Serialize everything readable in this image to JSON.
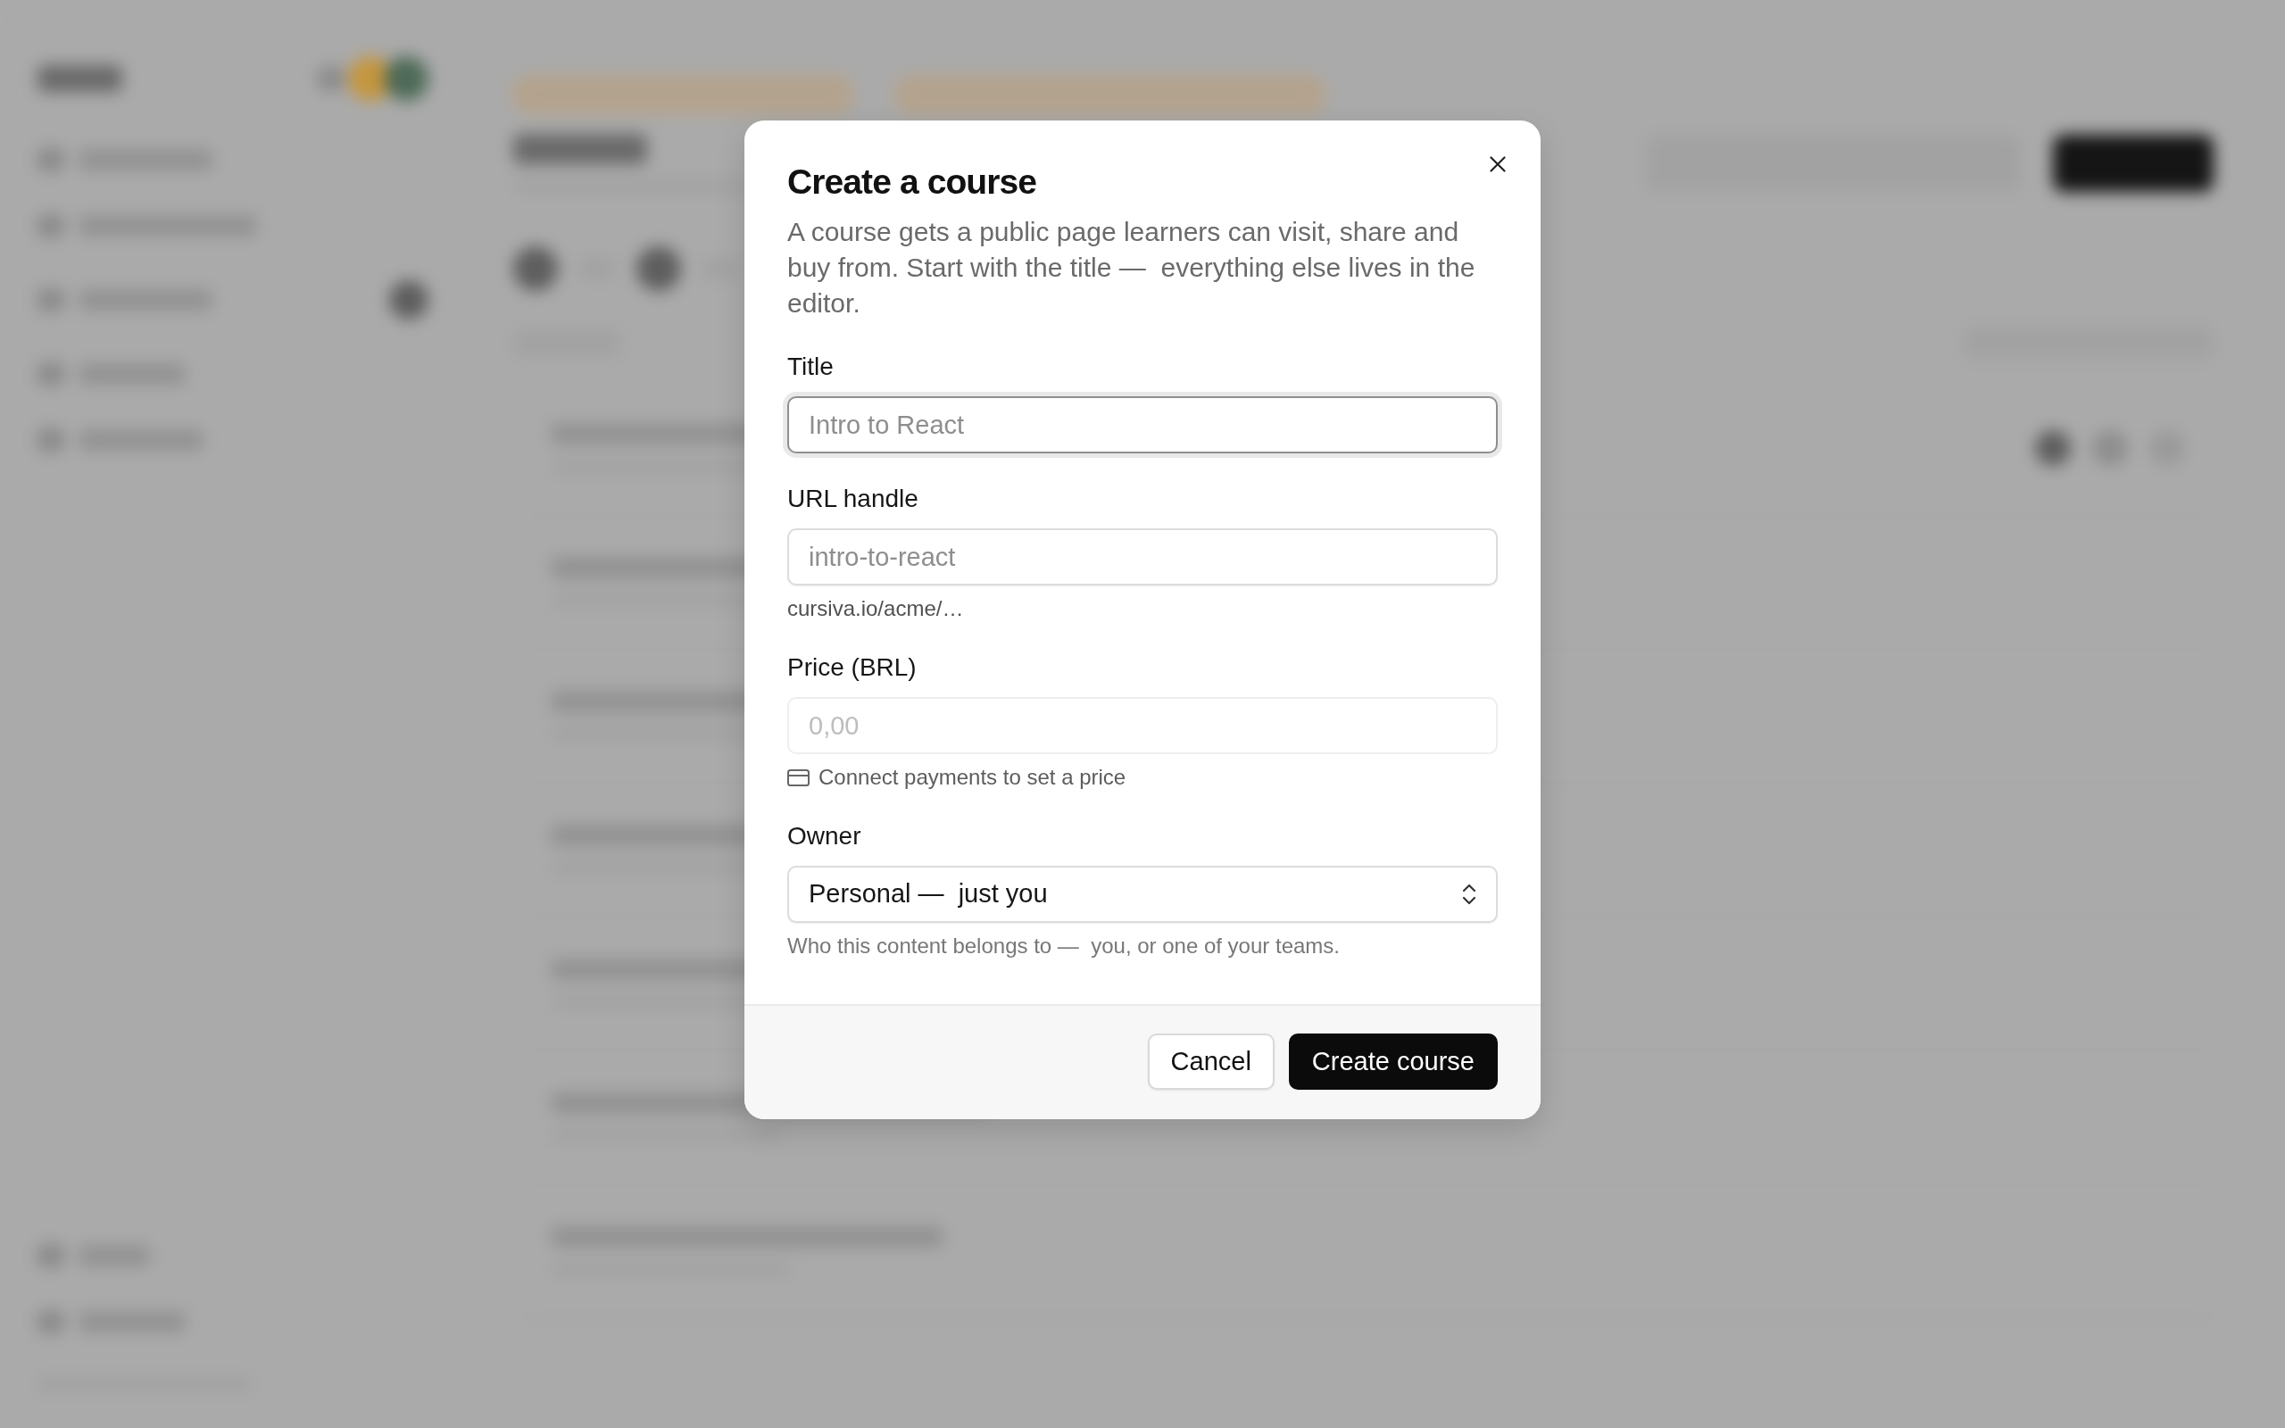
{
  "dialog": {
    "title": "Create a course",
    "description": "A course gets a public page learners can visit, share and buy from. Start with the title —  everything else lives in the editor.",
    "fields": [
      {
        "kind": "text",
        "label": "Title",
        "placeholder": "Intro to React",
        "focused": true,
        "disabled": false
      },
      {
        "kind": "text",
        "label": "URL handle",
        "placeholder": "intro-to-react",
        "focused": false,
        "disabled": false,
        "hint": {
          "kind": "preview",
          "text": "cursiva.io/acme/…"
        }
      },
      {
        "kind": "text",
        "label": "Price (BRL)",
        "placeholder": "0,00",
        "focused": false,
        "disabled": true,
        "hint": {
          "kind": "payment",
          "text": "Connect payments to set a price"
        }
      },
      {
        "kind": "select",
        "label": "Owner",
        "value": "Personal —  just you",
        "focused": false,
        "disabled": false,
        "hint": {
          "kind": "plain",
          "text": "Who this content belongs to —  you, or one of your teams."
        }
      }
    ],
    "buttons": [
      {
        "kind": "secondary",
        "label": "Cancel"
      },
      {
        "kind": "primary",
        "label": "Create course"
      }
    ]
  }
}
